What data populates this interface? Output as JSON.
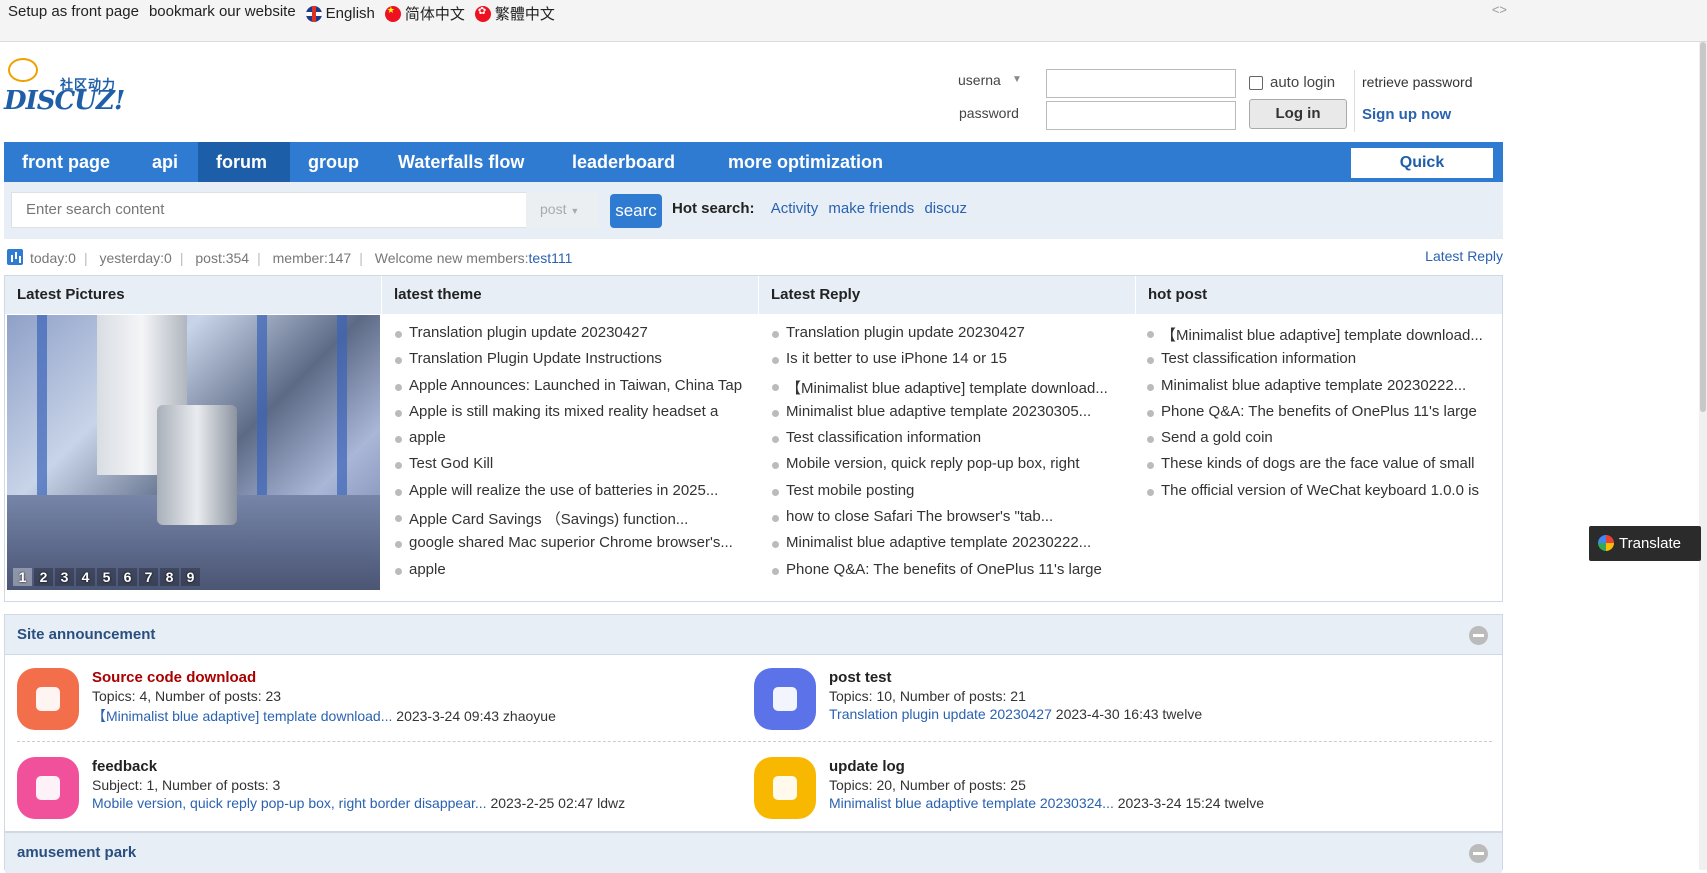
{
  "topbar": {
    "setup": "Setup as front page",
    "bookmark": "bookmark our website",
    "lang_en": "English",
    "lang_sc": "简体中文",
    "lang_tc": "繁體中文",
    "code_icon": "<>"
  },
  "logo": {
    "cn": "社区动力",
    "en": "DISCUZ!"
  },
  "login": {
    "user_label": "userna",
    "pass_label": "password",
    "auto_login": "auto login",
    "retrieve": "retrieve password",
    "login_btn": "Log in",
    "signup": "Sign up now"
  },
  "nav": {
    "items": [
      "front page",
      "api",
      "forum",
      "group",
      "Waterfalls flow",
      "leaderboard",
      "more optimization"
    ],
    "active": "forum",
    "quick": "Quick"
  },
  "search": {
    "placeholder": "Enter search content",
    "type": "post",
    "button": "searc",
    "hot_label": "Hot search:",
    "hot": [
      "Activity",
      "make friends",
      "discuz"
    ]
  },
  "stats": {
    "today": "today:0",
    "yesterday": "yesterday:0",
    "post": "post:354",
    "member": "member:147",
    "welcome": "Welcome new members:",
    "new_member": "test111",
    "latest_reply": "Latest Reply"
  },
  "panels": {
    "pictures": {
      "title": "Latest Pictures",
      "pages": [
        "1",
        "2",
        "3",
        "4",
        "5",
        "6",
        "7",
        "8",
        "9"
      ]
    },
    "theme": {
      "title": "latest theme",
      "items": [
        "Translation plugin update 20230427",
        "Translation Plugin Update Instructions",
        "Apple Announces: Launched in Taiwan, China Tap",
        "Apple is still making its mixed reality headset a",
        "apple",
        "Test God Kill",
        "Apple will realize the use of batteries in 2025...",
        "Apple Card Savings （Savings) function...",
        "google shared Mac superior Chrome browser's...",
        "apple"
      ]
    },
    "reply": {
      "title": "Latest Reply",
      "items": [
        "Translation plugin update 20230427",
        "Is it better to use iPhone 14 or 15",
        "【Minimalist blue adaptive] template download...",
        "Minimalist blue adaptive template 20230305...",
        "Test classification information",
        "Mobile version, quick reply pop-up box, right",
        "Test mobile posting",
        "how to close Safari The browser's \"tab...",
        "Minimalist blue adaptive template 20230222...",
        "Phone Q&A: The benefits of OnePlus 11's large"
      ]
    },
    "hot": {
      "title": "hot post",
      "items": [
        "【Minimalist blue adaptive] template download...",
        "Test classification information",
        "Minimalist blue adaptive template 20230222...",
        "Phone Q&A: The benefits of OnePlus 11's large",
        "Send a gold coin",
        "These kinds of dogs are the face value of small",
        "The official version of WeChat keyboard 1.0.0 is"
      ]
    }
  },
  "announcement": {
    "title": "Site announcement",
    "forums": [
      {
        "name": "Source code download",
        "meta": "Topics: 4, Number of posts: 23",
        "last_link": "【Minimalist blue adaptive] template download...",
        "last_info": " 2023-3-24 09:43 zhaoyue",
        "icon": "box-icon",
        "color": "#f36f4c"
      },
      {
        "name": "post test",
        "meta": "Topics: 10, Number of posts: 21",
        "last_link": "Translation plugin update 20230427",
        "last_info": " 2023-4-30 16:43 twelve",
        "icon": "chat-icon",
        "color": "#5b72e8"
      },
      {
        "name": "feedback",
        "meta": "Subject: 1, Number of posts: 3",
        "last_link": "Mobile version, quick reply pop-up box, right border disappear...",
        "last_info": " 2023-2-25 02:47 ldwz",
        "icon": "heart-icon",
        "color": "#f1509a"
      },
      {
        "name": "update log",
        "meta": "Topics: 20, Number of posts: 25",
        "last_link": "Minimalist blue adaptive template 20230324...",
        "last_info": " 2023-3-24 15:24 twelve",
        "icon": "note-icon",
        "color": "#f9b800"
      }
    ]
  },
  "amusement": {
    "title": "amusement park"
  },
  "translate_btn": "Translate"
}
